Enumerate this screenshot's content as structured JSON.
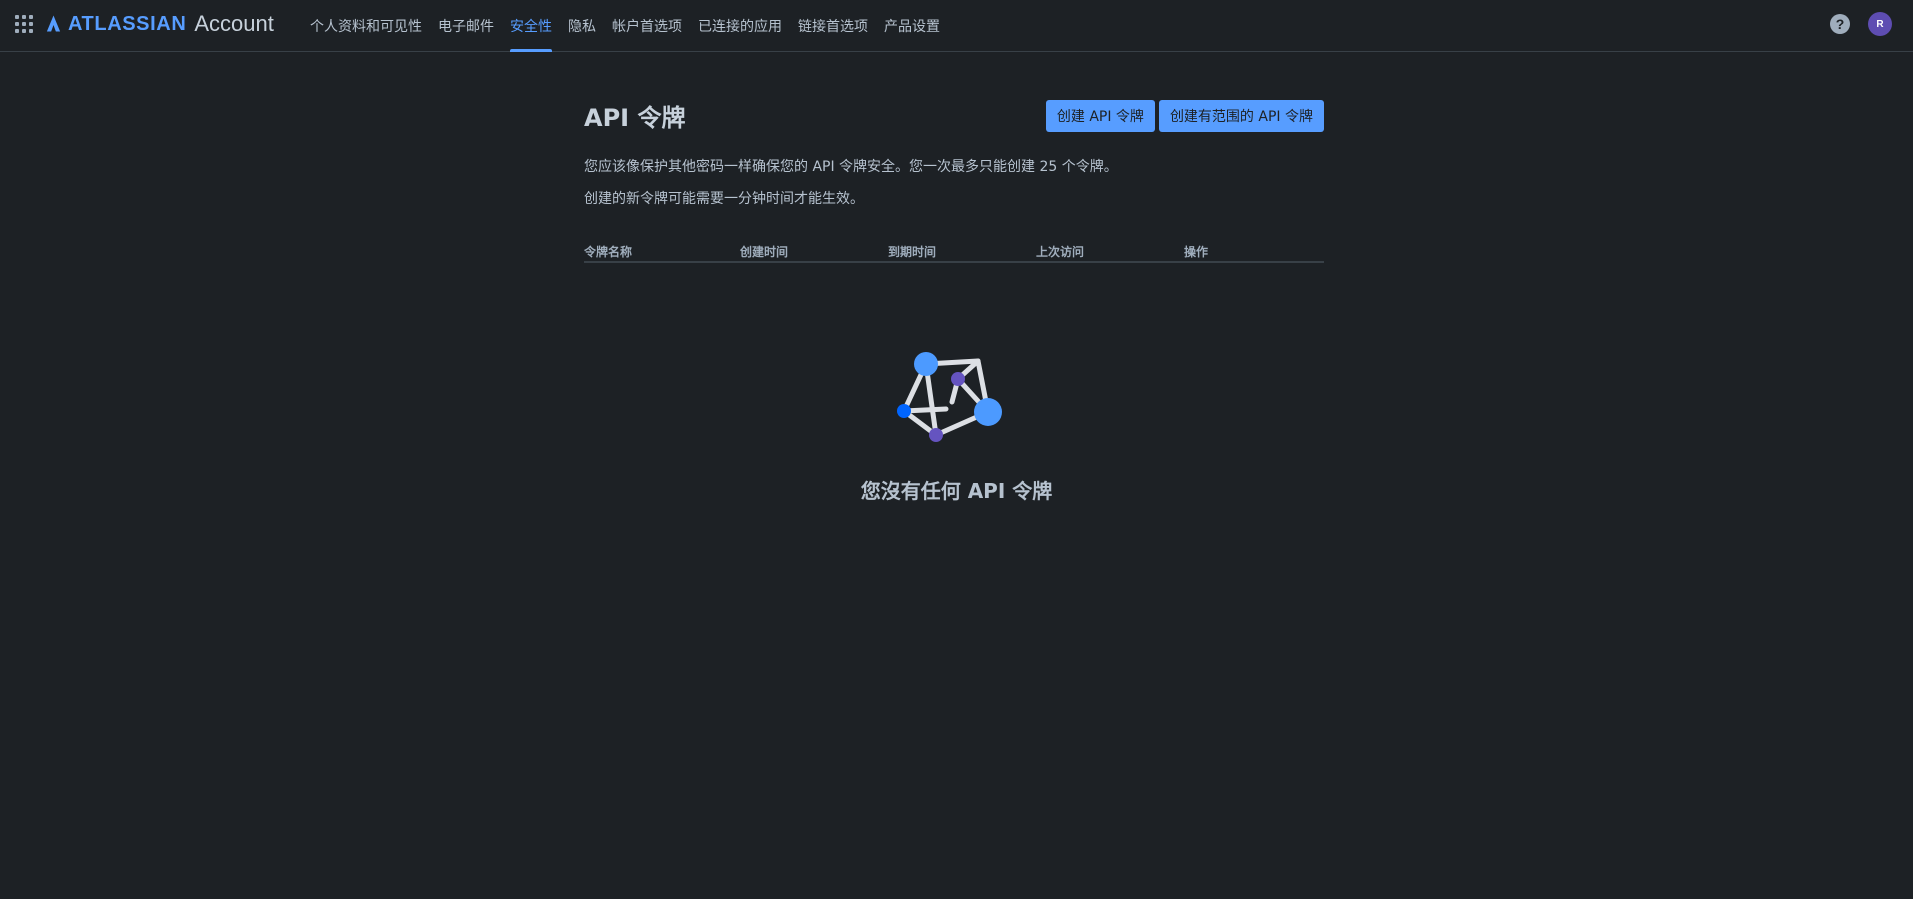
{
  "header": {
    "logo_word": "ATLASSIAN",
    "product": "Account",
    "avatar_initial": "R",
    "help_label": "?"
  },
  "nav": [
    {
      "label": "个人资料和可见性",
      "active": false
    },
    {
      "label": "电子邮件",
      "active": false
    },
    {
      "label": "安全性",
      "active": true
    },
    {
      "label": "隐私",
      "active": false
    },
    {
      "label": "帐户首选项",
      "active": false
    },
    {
      "label": "已连接的应用",
      "active": false
    },
    {
      "label": "链接首选项",
      "active": false
    },
    {
      "label": "产品设置",
      "active": false
    }
  ],
  "page": {
    "title": "API 令牌",
    "create_button": "创建 API 令牌",
    "create_scoped_button": "创建有范围的 API 令牌",
    "description_1": "您应该像保护其他密码一样确保您的 API 令牌安全。您一次最多只能创建 25 个令牌。",
    "description_2": "创建的新令牌可能需要一分钟时间才能生效。"
  },
  "table": {
    "columns": [
      "令牌名称",
      "创建时间",
      "到期时间",
      "上次访问",
      "操作"
    ]
  },
  "empty_state": {
    "title": "您沒有任何 API 令牌"
  },
  "colors": {
    "background": "#1d2125",
    "accent": "#579dff",
    "text": "#b6c2cf",
    "avatar": "#5e4db2"
  }
}
